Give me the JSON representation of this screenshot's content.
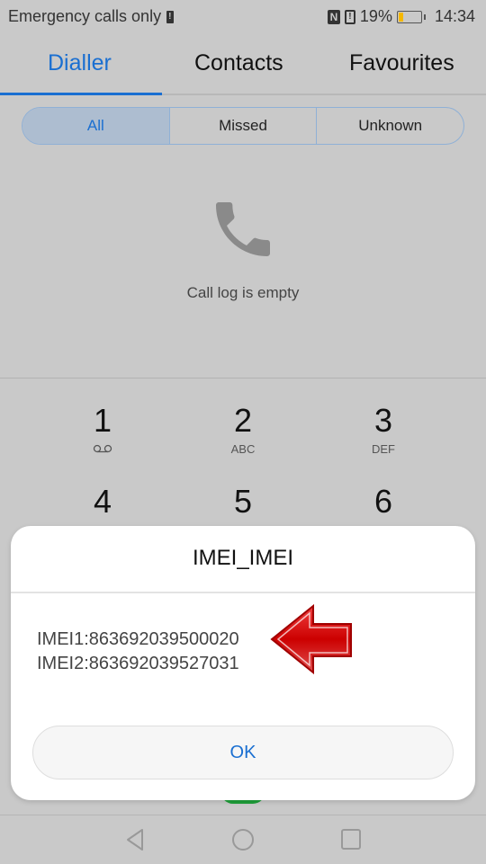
{
  "status_bar": {
    "carrier_text": "Emergency calls only",
    "nfc_label": "N",
    "sim_alert_label": "!",
    "battery_percent": "19%",
    "battery_level": 0.19,
    "battery_fill_color": "#f5b800",
    "time": "14:34"
  },
  "tabs": [
    {
      "label": "Dialler",
      "active": true
    },
    {
      "label": "Contacts",
      "active": false
    },
    {
      "label": "Favourites",
      "active": false
    }
  ],
  "filters": [
    {
      "label": "All",
      "active": true
    },
    {
      "label": "Missed",
      "active": false
    },
    {
      "label": "Unknown",
      "active": false
    }
  ],
  "call_log": {
    "icon": "phone-icon",
    "empty_message": "Call log is empty"
  },
  "keypad": [
    {
      "num": "1",
      "sub": "voicemail-icon"
    },
    {
      "num": "2",
      "sub": "ABC"
    },
    {
      "num": "3",
      "sub": "DEF"
    },
    {
      "num": "4",
      "sub": ""
    },
    {
      "num": "5",
      "sub": ""
    },
    {
      "num": "6",
      "sub": ""
    }
  ],
  "dialog": {
    "title": "IMEI_IMEI",
    "lines": [
      "IMEI1:863692039500020",
      "IMEI2:863692039527031"
    ],
    "ok_label": "OK",
    "annotation": "red-arrow-icon"
  },
  "colors": {
    "accent": "#1a6fd1",
    "background": "#c9c9c9",
    "arrow": "#d40000",
    "call_button": "#1fa03a"
  },
  "navbar": [
    "back-icon",
    "home-icon",
    "recents-icon"
  ]
}
